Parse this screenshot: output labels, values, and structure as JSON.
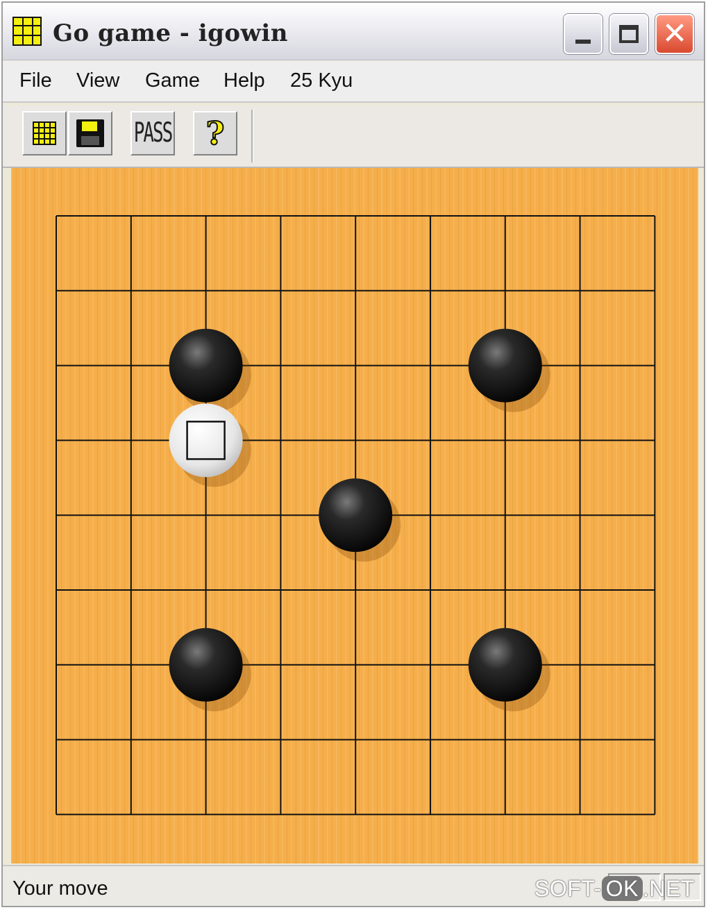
{
  "window": {
    "title": "Go game - igowin",
    "controls": {
      "minimize_icon": "minimize-icon",
      "maximize_icon": "maximize-icon",
      "close_icon": "close-icon",
      "close_glyph": "✕"
    }
  },
  "menu": {
    "items": [
      {
        "label": "File"
      },
      {
        "label": "View"
      },
      {
        "label": "Game"
      },
      {
        "label": "Help"
      },
      {
        "label": "25 Kyu"
      }
    ]
  },
  "toolbar": {
    "buttons": [
      {
        "icon": "board-grid-icon"
      },
      {
        "icon": "save-disk-icon"
      },
      {
        "icon": "pass-icon",
        "label": "PASS"
      },
      {
        "icon": "help-icon",
        "label": "?"
      }
    ]
  },
  "board": {
    "size": 9,
    "star_points": [
      [
        2,
        2
      ],
      [
        6,
        2
      ],
      [
        4,
        4
      ],
      [
        2,
        6
      ],
      [
        6,
        6
      ]
    ],
    "stones": [
      {
        "color": "black",
        "col": 2,
        "row": 2
      },
      {
        "color": "black",
        "col": 6,
        "row": 2
      },
      {
        "color": "white",
        "col": 2,
        "row": 3,
        "last_move_marker": "square"
      },
      {
        "color": "black",
        "col": 4,
        "row": 4
      },
      {
        "color": "black",
        "col": 2,
        "row": 6
      },
      {
        "color": "black",
        "col": 6,
        "row": 6
      }
    ],
    "colors": {
      "wood": "#f5ae4a",
      "line": "#111111",
      "black_stone": "#1a1a1a",
      "white_stone": "#f2f2f2"
    }
  },
  "status": {
    "text": "Your move"
  },
  "watermark": {
    "pre": "SOFT-",
    "ok": "OK",
    "post": ".NET"
  }
}
